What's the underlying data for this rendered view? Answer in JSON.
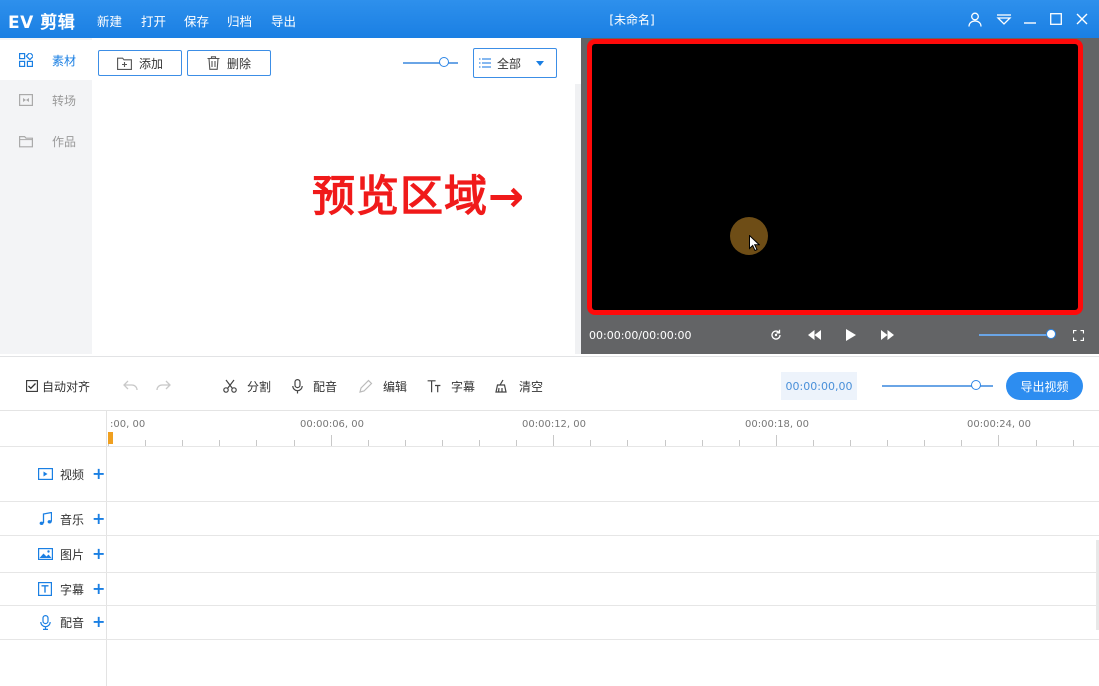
{
  "app": {
    "logo": "EV 剪辑",
    "menu": [
      "新建",
      "打开",
      "保存",
      "归档",
      "导出"
    ],
    "document_title": "[未命名]",
    "window_icons": [
      "user-icon",
      "dropdown-menu-icon",
      "minimize-icon",
      "maximize-icon",
      "close-icon"
    ]
  },
  "sidebar": {
    "items": [
      {
        "label": "素材",
        "icon": "grid-icon",
        "active": true
      },
      {
        "label": "转场",
        "icon": "transition-icon",
        "active": false
      },
      {
        "label": "作品",
        "icon": "folder-icon",
        "active": false
      }
    ]
  },
  "media": {
    "add_label": "添加",
    "delete_label": "删除",
    "filter_selected": "全部",
    "zoom_level": 0.74
  },
  "annotation": {
    "text": "预览区域→",
    "color": "#f01a1a"
  },
  "preview": {
    "time": "00:00:00/00:00:00",
    "volume_level": 1.0,
    "controls": [
      "replay-icon",
      "rewind-icon",
      "play-icon",
      "fast-forward-icon",
      "fullscreen-icon"
    ],
    "highlight_color": "#ff0a0a"
  },
  "toolbar": {
    "auto_align_label": "自动对齐",
    "auto_align_checked": true,
    "split_label": "分割",
    "dub_label": "配音",
    "edit_label": "编辑",
    "subtitle_label": "字幕",
    "clear_label": "清空",
    "timecode": "00:00:00,00",
    "zoom_level": 0.85,
    "export_label": "导出视频"
  },
  "timeline": {
    "ruler_labels": [
      ":00, 00",
      "00:00:06, 00",
      "00:00:12, 00",
      "00:00:18, 00",
      "00:00:24, 00"
    ],
    "tracks": [
      {
        "label": "视频",
        "icon": "video-icon"
      },
      {
        "label": "音乐",
        "icon": "music-icon"
      },
      {
        "label": "图片",
        "icon": "image-icon"
      },
      {
        "label": "字幕",
        "icon": "text-icon"
      },
      {
        "label": "配音",
        "icon": "microphone-icon"
      }
    ]
  },
  "colors": {
    "accent": "#1a7fe3",
    "titlebar": "#2188ea"
  }
}
